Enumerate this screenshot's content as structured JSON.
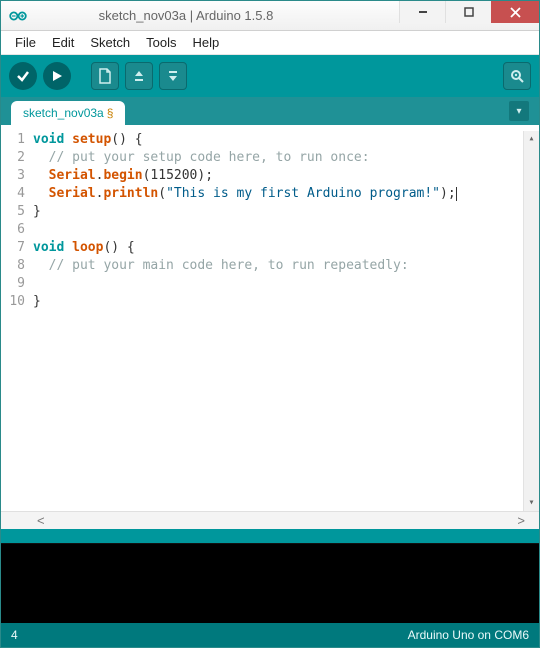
{
  "window": {
    "title": "sketch_nov03a | Arduino 1.5.8"
  },
  "menu": {
    "file": "File",
    "edit": "Edit",
    "sketch": "Sketch",
    "tools": "Tools",
    "help": "Help"
  },
  "tab": {
    "name": "sketch_nov03a",
    "modified_marker": "§"
  },
  "code": {
    "lines": [
      {
        "n": "1"
      },
      {
        "n": "2"
      },
      {
        "n": "3"
      },
      {
        "n": "4"
      },
      {
        "n": "5"
      },
      {
        "n": "6"
      },
      {
        "n": "7"
      },
      {
        "n": "8"
      },
      {
        "n": "9"
      },
      {
        "n": "10"
      }
    ],
    "l1_kw": "void",
    "l1_fn": "setup",
    "l1_rest": "() {",
    "l2": "  // put your setup code here, to run once:",
    "l3_obj": "  Serial",
    "l3_dot": ".",
    "l3_fn": "begin",
    "l3_open": "(",
    "l3_num": "115200",
    "l3_close": ");",
    "l4_obj": "  Serial",
    "l4_dot": ".",
    "l4_fn": "println",
    "l4_open": "(",
    "l4_str": "\"This is my first Arduino program!\"",
    "l4_close": ");",
    "l5": "}",
    "l6": "",
    "l7_kw": "void",
    "l7_fn": "loop",
    "l7_rest": "() {",
    "l8": "  // put your main code here, to run repeatedly:",
    "l9": "",
    "l10": "}"
  },
  "status": {
    "line_number": "4",
    "board": "Arduino Uno on COM6"
  }
}
